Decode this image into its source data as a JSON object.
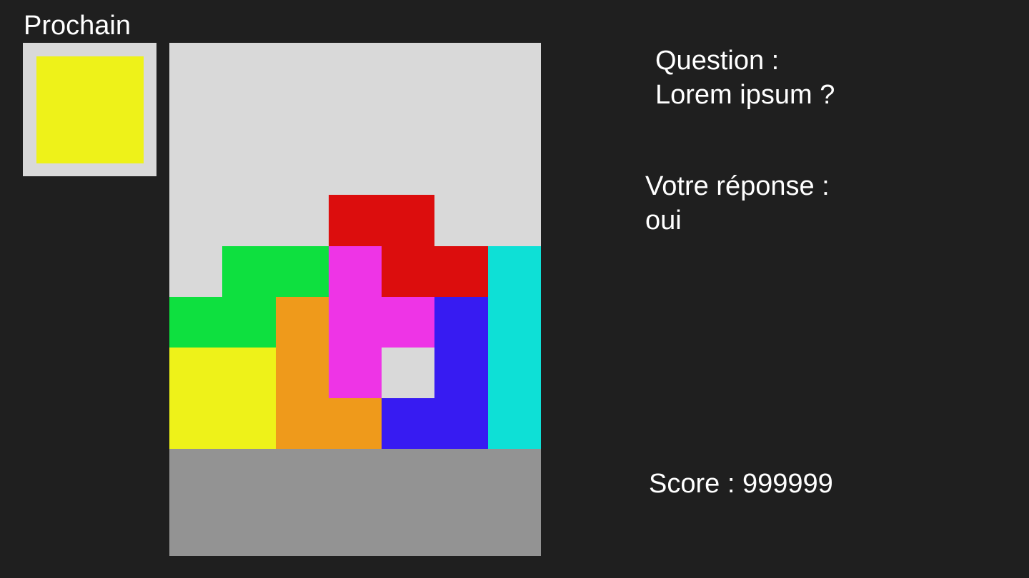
{
  "next": {
    "label": "Prochain",
    "piece_color": "#eef219"
  },
  "board": {
    "columns": 7,
    "visible_rows": 10,
    "empty_color": "#d9d9d9",
    "floor_color": "#939393",
    "cells": [
      {
        "row": 3,
        "col": 3,
        "color": "#dc0d0d"
      },
      {
        "row": 3,
        "col": 4,
        "color": "#dc0d0d"
      },
      {
        "row": 4,
        "col": 4,
        "color": "#dc0d0d"
      },
      {
        "row": 4,
        "col": 5,
        "color": "#dc0d0d"
      },
      {
        "row": 4,
        "col": 1,
        "color": "#0ee03f"
      },
      {
        "row": 4,
        "col": 2,
        "color": "#0ee03f"
      },
      {
        "row": 5,
        "col": 0,
        "color": "#0ee03f"
      },
      {
        "row": 5,
        "col": 1,
        "color": "#0ee03f"
      },
      {
        "row": 4,
        "col": 3,
        "color": "#ee34e6"
      },
      {
        "row": 5,
        "col": 3,
        "color": "#ee34e6"
      },
      {
        "row": 5,
        "col": 4,
        "color": "#ee34e6"
      },
      {
        "row": 6,
        "col": 3,
        "color": "#ee34e6"
      },
      {
        "row": 4,
        "col": 6,
        "color": "#0ee0d6"
      },
      {
        "row": 5,
        "col": 6,
        "color": "#0ee0d6"
      },
      {
        "row": 6,
        "col": 6,
        "color": "#0ee0d6"
      },
      {
        "row": 7,
        "col": 6,
        "color": "#0ee0d6"
      },
      {
        "row": 5,
        "col": 2,
        "color": "#ef9a1b"
      },
      {
        "row": 6,
        "col": 2,
        "color": "#ef9a1b"
      },
      {
        "row": 7,
        "col": 2,
        "color": "#ef9a1b"
      },
      {
        "row": 7,
        "col": 3,
        "color": "#ef9a1b"
      },
      {
        "row": 5,
        "col": 5,
        "color": "#371bf2"
      },
      {
        "row": 6,
        "col": 5,
        "color": "#371bf2"
      },
      {
        "row": 7,
        "col": 4,
        "color": "#371bf2"
      },
      {
        "row": 7,
        "col": 5,
        "color": "#371bf2"
      },
      {
        "row": 6,
        "col": 0,
        "color": "#eef219"
      },
      {
        "row": 6,
        "col": 1,
        "color": "#eef219"
      },
      {
        "row": 7,
        "col": 0,
        "color": "#eef219"
      },
      {
        "row": 7,
        "col": 1,
        "color": "#eef219"
      }
    ]
  },
  "question": {
    "label": "Question :",
    "text": "Lorem ipsum ?"
  },
  "answer": {
    "label": "Votre réponse :",
    "value": "oui"
  },
  "score": {
    "text": "Score : 999999"
  }
}
